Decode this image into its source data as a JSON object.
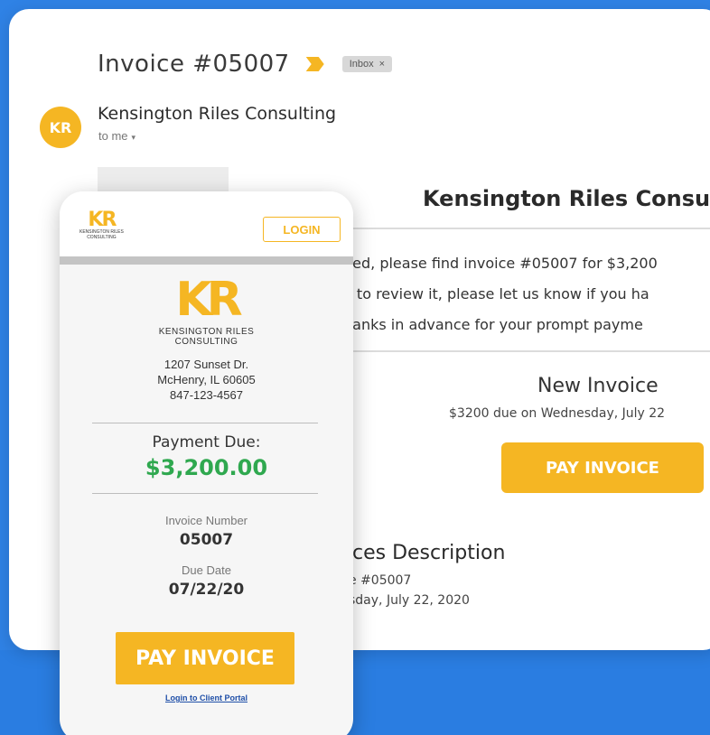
{
  "email": {
    "subject": "Invoice #05007",
    "label_badge": "Inbox",
    "label_badge_close": "×",
    "avatar_initials": "KR",
    "sender_name": "Kensington Riles Consulting",
    "recipient": "to me",
    "recipient_caret": "▾",
    "company_heading": "Kensington Riles Consu",
    "body_lines": [
      "ned, please find invoice #05007 for $3,200",
      "e to review it, please let us know if you ha",
      "hanks in advance for your prompt payme"
    ],
    "new_invoice_title": "New Invoice",
    "new_invoice_due": "$3200 due on Wednesday, July 22",
    "pay_button": "PAY INVOICE",
    "services_title": "ces Description",
    "services_lines": [
      "e #05007",
      "sday, July 22, 2020"
    ]
  },
  "portal": {
    "mini_logo": "KR",
    "mini_logo_sub": "KENSINGTON RILES",
    "mini_logo_sub2": "CONSULTING",
    "login_button": "LOGIN",
    "logo": "KR",
    "company_line1": "KENSINGTON RILES",
    "company_line2": "CONSULTING",
    "address_line1": "1207 Sunset Dr.",
    "address_line2": "McHenry, IL 60605",
    "phone": "847-123-4567",
    "payment_due_label": "Payment Due:",
    "payment_due_amount": "$3,200.00",
    "invoice_number_label": "Invoice Number",
    "invoice_number": "05007",
    "due_date_label": "Due Date",
    "due_date": "07/22/20",
    "pay_button": "PAY INVOICE",
    "portal_link": "Login to Client Portal"
  },
  "colors": {
    "background": "#2a7de1",
    "accent": "#f5b623",
    "amount_green": "#2fa84f"
  }
}
